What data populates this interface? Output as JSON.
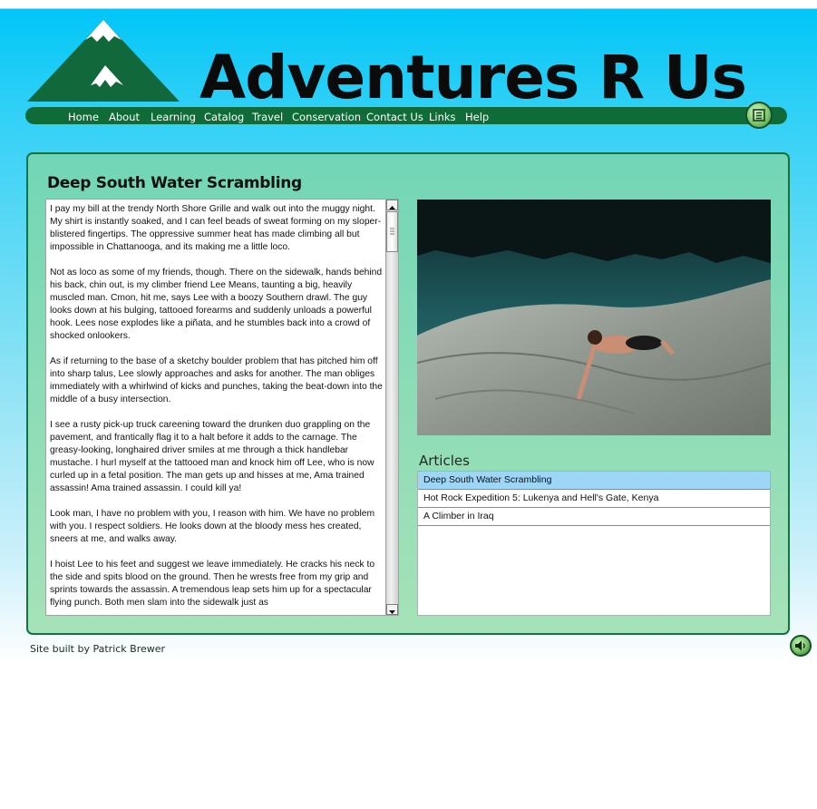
{
  "site": {
    "title": "Adventures R Us",
    "logo_icon": "mountain-logo-icon"
  },
  "nav": {
    "items": [
      {
        "label": "Home"
      },
      {
        "label": "About"
      },
      {
        "label": "Learning"
      },
      {
        "label": "Catalog"
      },
      {
        "label": "Travel"
      },
      {
        "label": "Conservation"
      },
      {
        "label": "Contact Us"
      },
      {
        "label": "Links"
      },
      {
        "label": "Help"
      }
    ],
    "cart_icon": "cart-icon"
  },
  "article": {
    "title": "Deep South Water Scrambling",
    "paragraphs": [
      "I pay my bill at the trendy North Shore Grille and walk out into the muggy night. My shirt is instantly soaked, and I can feel beads of sweat forming on my sloper-blistered fingertips. The oppressive summer heat has made climbing all but impossible in Chattanooga, and its making me a little loco.",
      "Not as loco as some of my friends, though. There on the sidewalk, hands behind his back, chin out, is my climber friend Lee Means, taunting a big, heavily muscled man. Cmon, hit me, says Lee with a boozy Southern drawl. The guy looks down at his bulging, tattooed forearms and suddenly unloads a powerful hook. Lees nose explodes like a piñata, and he stumbles back into a crowd of shocked onlookers.",
      "As if returning to the base of a sketchy boulder problem that has pitched him off into sharp talus, Lee slowly approaches and asks for another. The man obliges immediately with a whirlwind of kicks and punches, taking the beat-down into the middle of a busy intersection.",
      "I see a rusty pick-up truck careening toward the drunken duo grappling on the pavement, and frantically flag it to a halt before it adds to the carnage. The greasy-looking, longhaired driver smiles at me through a thick handlebar mustache. I hurl myself at the tattooed man and knock him off Lee, who is now curled up in a fetal position. The man gets up and hisses at me, Ama trained assassin! Ama trained assassin. I could kill ya!",
      "Look man, I have no problem with you, I reason with him. We have no problem with you. I respect soldiers. He looks down at the bloody mess hes created, sneers at me, and walks away.",
      "I hoist Lee to his feet and suggest we leave immediately. He cracks his neck to the side and spits blood on the ground. Then he wrests free from my grip and sprints towards the assassin. A tremendous leap sets him up for a spectacular flying punch. Both men slam into the sidewalk just as"
    ]
  },
  "articles": {
    "heading": "Articles",
    "items": [
      {
        "label": "Deep South Water Scrambling",
        "selected": true
      },
      {
        "label": "Hot Rock Expedition 5: Lukenya and Hell's Gate, Kenya",
        "selected": false
      },
      {
        "label": "A Climber in Iraq",
        "selected": false
      }
    ]
  },
  "footer": {
    "credit": "Site built by Patrick Brewer",
    "sound_icon": "speaker-icon"
  },
  "colors": {
    "accent_green": "#0f6b38",
    "sky_blue": "#00c6f7",
    "selected_row": "#9ed6f7"
  }
}
